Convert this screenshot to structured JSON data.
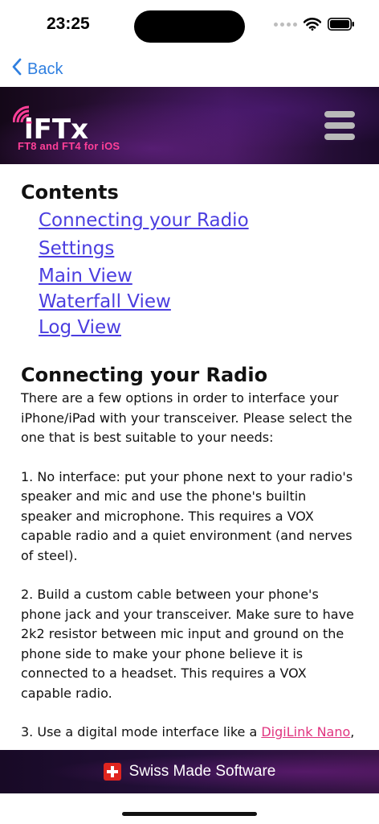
{
  "status_bar": {
    "time": "23:25"
  },
  "nav": {
    "back_label": "Back"
  },
  "banner": {
    "logo_text": "iFTx",
    "tagline": "FT8 and FT4 for iOS"
  },
  "contents": {
    "heading": "Contents",
    "items": [
      {
        "label": "Connecting your Radio"
      },
      {
        "label": "Settings"
      },
      {
        "label": "Main View"
      },
      {
        "label": "Waterfall View"
      },
      {
        "label": "Log View"
      }
    ]
  },
  "section": {
    "heading": "Connecting your Radio",
    "intro": "There are a few options in order to interface your iPhone/iPad with your transceiver. Please select the one that is best suitable to your needs:",
    "option1": "1. No interface: put your phone next to your radio's speaker and mic and use the phone's builtin speaker and microphone. This requires a VOX capable radio and a quiet environment (and nerves of steel).",
    "option2": "2. Build a custom cable between your phone's phone jack and your transceiver. Make sure to have 2k2 resistor between mic input and ground on the phone side to make your phone believe it is connected to a headset. This requires a VOX capable radio.",
    "option3_prefix": "3. Use a digital mode interface like a ",
    "option3_link": "DigiLink Nano",
    "option3_suffix": ","
  },
  "footer": {
    "label": "Swiss Made Software"
  },
  "colors": {
    "link": "#4b3ee0",
    "inline_link": "#e0347f",
    "back": "#2f7fe0",
    "brand_pink": "#ff3f98"
  }
}
